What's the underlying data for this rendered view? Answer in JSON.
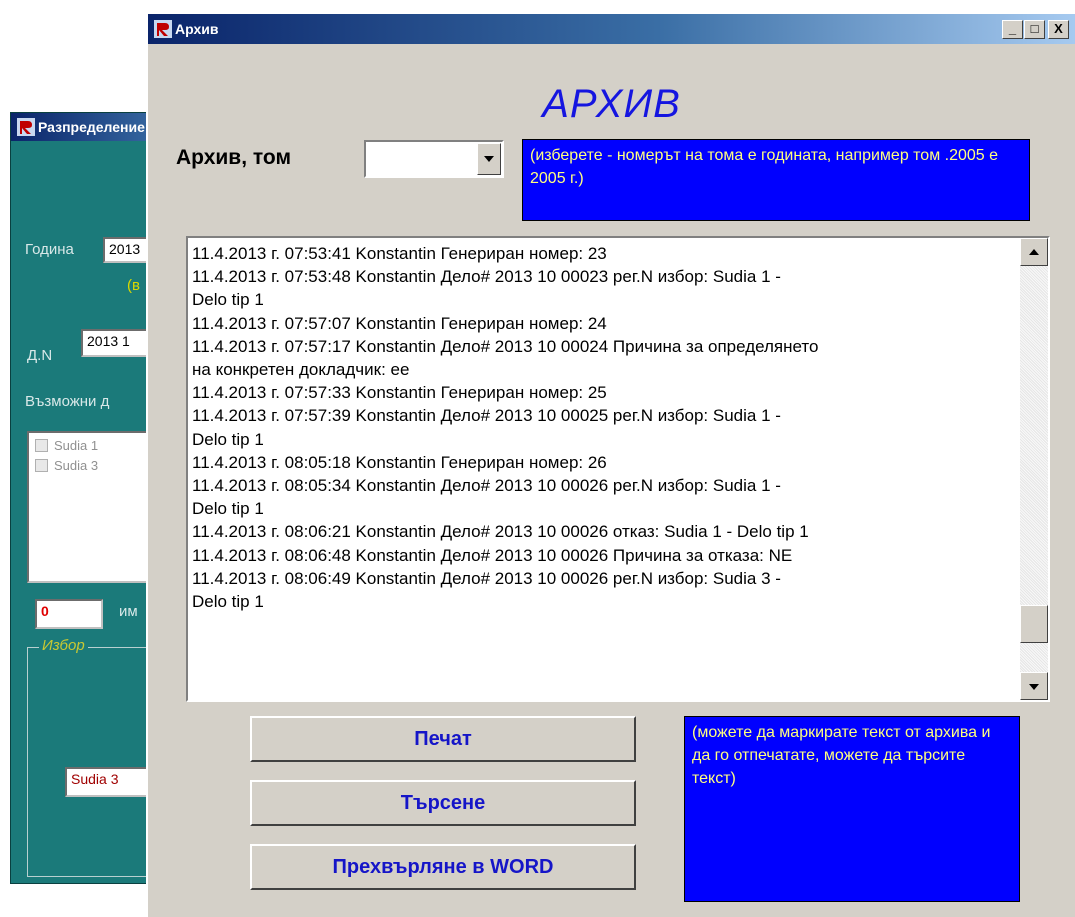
{
  "bg_window": {
    "title": "Разпределение",
    "year_label": "Година",
    "year_value": "2013",
    "year_hint": "(в",
    "case_label": "Д.N",
    "case_value": "2013 1",
    "possible_label": "Възможни д",
    "judges": [
      "Sudia 1",
      "Sudia 3"
    ],
    "count_value": "0",
    "count_label": "им",
    "group_label": "Избор",
    "selection_value": "Sudia 3"
  },
  "window": {
    "title": "Архив",
    "caption_buttons": [
      "_",
      "□",
      "X"
    ]
  },
  "heading": "АРХИВ",
  "volume": {
    "label": "Архив, том",
    "value": "",
    "hint": "(изберете - номерът на тома е годината, например том .2005 е 2005 г.)"
  },
  "log_lines": [
    "11.4.2013 г. 07:53:41 Konstantin Генериран номер: 23",
    "11.4.2013 г. 07:53:48 Konstantin Дело# 2013  10 00023 рег.N  избор: Sudia 1 -",
    "Delo tip 1",
    "11.4.2013 г. 07:57:07 Konstantin Генериран номер: 24",
    "11.4.2013 г. 07:57:17 Konstantin Дело# 2013  10 00024 Причина за определянето",
    "на конкретен докладчик: ее",
    "11.4.2013 г. 07:57:33 Konstantin Генериран номер: 25",
    "11.4.2013 г. 07:57:39 Konstantin Дело# 2013  10 00025 рег.N  избор: Sudia 1 -",
    "Delo tip 1",
    "11.4.2013 г. 08:05:18 Konstantin Генериран номер: 26",
    "11.4.2013 г. 08:05:34 Konstantin Дело# 2013  10 00026 рег.N  избор: Sudia 1 -",
    "Delo tip 1",
    "11.4.2013 г. 08:06:21 Konstantin Дело# 2013  10 00026 отказ: Sudia 1 - Delo tip 1",
    "11.4.2013 г. 08:06:48 Konstantin Дело# 2013  10 00026 Причина за отказа: NE",
    "11.4.2013 г. 08:06:49 Konstantin Дело# 2013  10 00026 рег.N  избор: Sudia 3 -",
    "Delo tip 1"
  ],
  "log_scroll_position": 0.92,
  "buttons": {
    "print": "Печат",
    "search": "Търсене",
    "word": "Прехвърляне в WORD"
  },
  "print_hint": "(можете да маркирате текст от архива и да го отпечатате, можете да търсите текст)",
  "colors": {
    "heading": "#1515e0",
    "hint_bg": "#0000ff",
    "hint_text": "#ffff80",
    "button_text": "#1515c8",
    "bg_window": "#1b7a7a"
  }
}
